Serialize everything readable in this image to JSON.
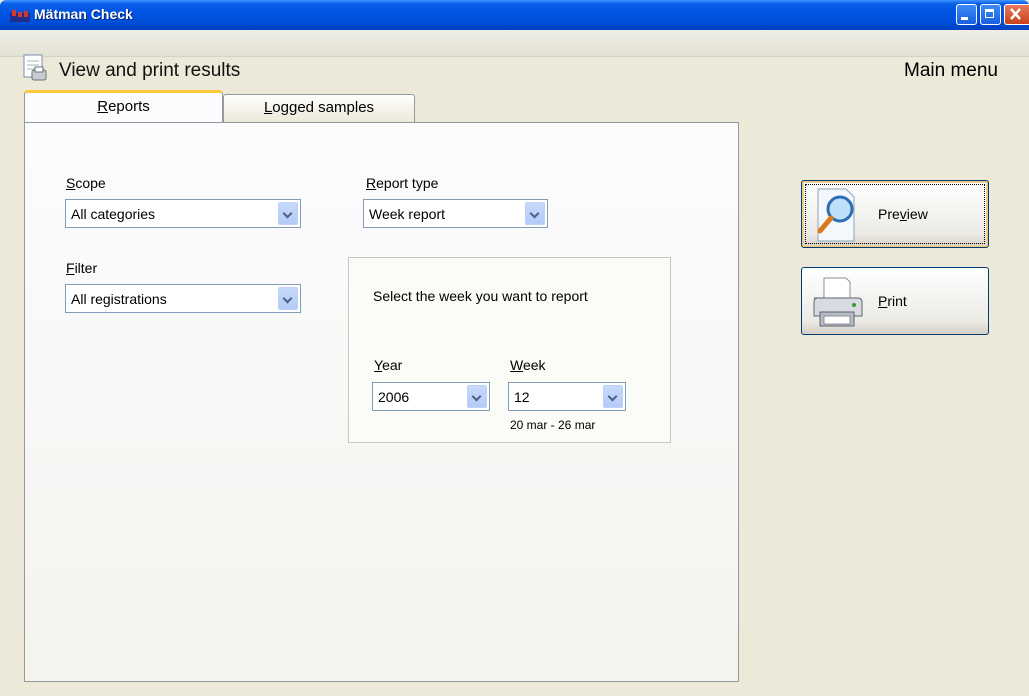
{
  "window": {
    "title": "Mätman Check"
  },
  "header": {
    "title": "View and print results",
    "main_menu": "Main menu"
  },
  "tabs": [
    {
      "label": "Reports",
      "mnemonic": "R",
      "rest": "eports",
      "active": true
    },
    {
      "label": "Logged samples",
      "mnemonic": "L",
      "rest": "ogged samples",
      "active": false
    }
  ],
  "scope": {
    "label_u": "S",
    "label_rest": "cope",
    "value": "All categories"
  },
  "filter": {
    "label_u": "F",
    "label_rest": "ilter",
    "value": "All registrations"
  },
  "report_type": {
    "label_u": "R",
    "label_rest": "eport type",
    "value": "Week report"
  },
  "week_select": {
    "prompt": "Select the week you want to report",
    "year": {
      "label_u": "Y",
      "label_rest": "ear",
      "value": "2006"
    },
    "week": {
      "label_u": "W",
      "label_rest": "eek",
      "value": "12"
    },
    "range": "20 mar - 26 mar"
  },
  "buttons": {
    "preview": {
      "pre": "Pre",
      "u": "v",
      "post": "iew"
    },
    "print": {
      "pre": "",
      "u": "P",
      "post": "rint"
    }
  },
  "colors": {
    "titlebar": "#0054e3",
    "face": "#ece9d8",
    "tab_highlight": "#ffc83c",
    "border": "#003c74"
  }
}
